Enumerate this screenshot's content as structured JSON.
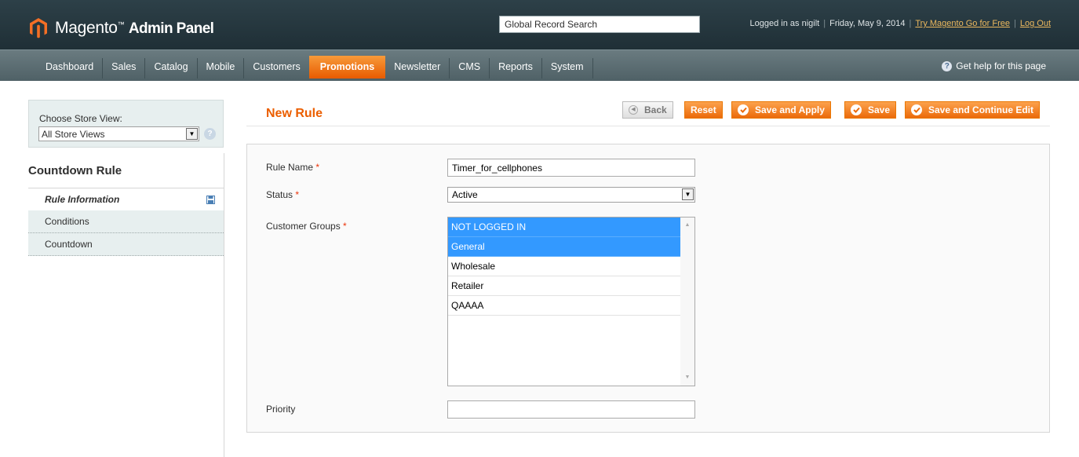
{
  "header": {
    "app_title": "Magento",
    "app_title_tm": "™",
    "app_subtitle": "Admin Panel",
    "search_value": "Global Record Search",
    "logged_in_text": "Logged in as nigilt",
    "date_text": "Friday, May 9, 2014",
    "try_link": "Try Magento Go for Free",
    "logout_link": "Log Out",
    "separator": "|"
  },
  "nav": {
    "items": [
      {
        "label": "Dashboard"
      },
      {
        "label": "Sales"
      },
      {
        "label": "Catalog"
      },
      {
        "label": "Mobile"
      },
      {
        "label": "Customers"
      },
      {
        "label": "Promotions"
      },
      {
        "label": "Newsletter"
      },
      {
        "label": "CMS"
      },
      {
        "label": "Reports"
      },
      {
        "label": "System"
      }
    ],
    "active": "Promotions",
    "help_label": "Get help for this page"
  },
  "sidebar": {
    "store_label": "Choose Store View:",
    "store_value": "All Store Views",
    "title": "Countdown Rule",
    "tabs": [
      {
        "label": "Rule Information",
        "active": true
      },
      {
        "label": "Conditions",
        "active": false
      },
      {
        "label": "Countdown",
        "active": false
      }
    ]
  },
  "content": {
    "page_title": "New Rule",
    "buttons": {
      "back": "Back",
      "reset": "Reset",
      "save_apply": "Save and Apply",
      "save": "Save",
      "save_continue": "Save and Continue Edit"
    },
    "required_mark": "*",
    "fields": {
      "rule_name_label": "Rule Name",
      "rule_name_value": "Timer_for_cellphones",
      "status_label": "Status",
      "status_value": "Active",
      "groups_label": "Customer Groups",
      "groups_options": [
        {
          "label": "NOT LOGGED IN",
          "selected": true
        },
        {
          "label": "General",
          "selected": true
        },
        {
          "label": "Wholesale",
          "selected": false
        },
        {
          "label": "Retailer",
          "selected": false
        },
        {
          "label": "QAAAA",
          "selected": false
        }
      ],
      "priority_label": "Priority",
      "priority_value": ""
    }
  },
  "colors": {
    "accent_orange": "#eb5e00",
    "header_bg": "#2d4048",
    "nav_bg": "#5c6e73",
    "selection_blue": "#3399ff"
  }
}
